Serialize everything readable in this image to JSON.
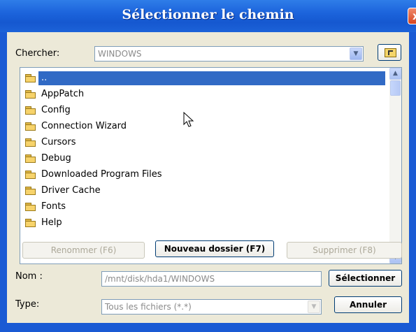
{
  "window": {
    "title": "Sélectionner le chemin",
    "close_label": "x"
  },
  "search": {
    "label": "Chercher:",
    "value": "WINDOWS"
  },
  "folders": [
    {
      "name": "..",
      "selected": true
    },
    {
      "name": "AppPatch",
      "selected": false
    },
    {
      "name": "Config",
      "selected": false
    },
    {
      "name": "Connection Wizard",
      "selected": false
    },
    {
      "name": "Cursors",
      "selected": false
    },
    {
      "name": "Debug",
      "selected": false
    },
    {
      "name": "Downloaded Program Files",
      "selected": false
    },
    {
      "name": "Driver Cache",
      "selected": false
    },
    {
      "name": "Fonts",
      "selected": false
    },
    {
      "name": "Help",
      "selected": false
    }
  ],
  "buttons": {
    "rename": "Renommer (F6)",
    "new_folder": "Nouveau dossier (F7)",
    "delete": "Supprimer (F8)",
    "select": "Sélectionner",
    "cancel": "Annuler"
  },
  "name_field": {
    "label": "Nom :",
    "value": "/mnt/disk/hda1/WINDOWS"
  },
  "type_field": {
    "label": "Type:",
    "value": "Tous les fichiers (*.*)"
  }
}
